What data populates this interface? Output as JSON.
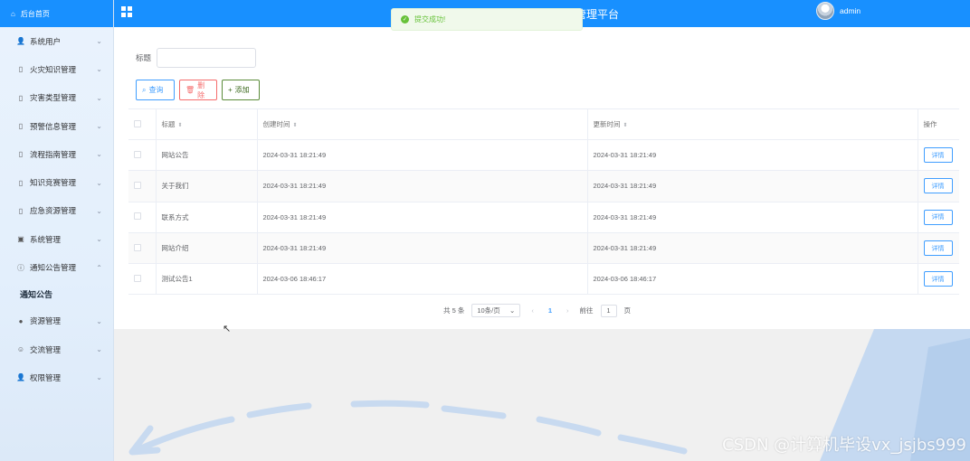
{
  "sidebar": {
    "home": "后台首页",
    "items": [
      {
        "label": "系统用户",
        "icon": "user-icon",
        "expanded": false
      },
      {
        "label": "火灾知识管理",
        "icon": "document-icon",
        "expanded": false
      },
      {
        "label": "灾害类型管理",
        "icon": "document-icon",
        "expanded": false
      },
      {
        "label": "预警信息管理",
        "icon": "document-icon",
        "expanded": false
      },
      {
        "label": "流程指南管理",
        "icon": "document-icon",
        "expanded": false
      },
      {
        "label": "知识竞赛管理",
        "icon": "document-icon",
        "expanded": false
      },
      {
        "label": "应急资源管理",
        "icon": "document-icon",
        "expanded": false
      },
      {
        "label": "系统管理",
        "icon": "picture-icon",
        "expanded": false
      },
      {
        "label": "通知公告管理",
        "icon": "info-icon",
        "expanded": true
      }
    ],
    "sub_item": "通知公告",
    "items_after": [
      {
        "label": "资源管理",
        "icon": "location-icon"
      },
      {
        "label": "交流管理",
        "icon": "chat-icon"
      },
      {
        "label": "权限管理",
        "icon": "user-icon"
      }
    ]
  },
  "header": {
    "title": "管理平台",
    "username": "admin"
  },
  "toast": {
    "message": "提交成功!",
    "status_color": "#67c23a"
  },
  "search": {
    "label": "标题",
    "value": ""
  },
  "buttons": {
    "query": "查询",
    "delete": "删除",
    "add": "添加"
  },
  "table": {
    "headers": {
      "title": "标题",
      "created": "创建时间",
      "updated": "更新时间",
      "actions": "操作"
    },
    "rows": [
      {
        "title": "网站公告",
        "created": "2024-03-31 18:21:49",
        "updated": "2024-03-31 18:21:49",
        "action": "详情"
      },
      {
        "title": "关于我们",
        "created": "2024-03-31 18:21:49",
        "updated": "2024-03-31 18:21:49",
        "action": "详情"
      },
      {
        "title": "联系方式",
        "created": "2024-03-31 18:21:49",
        "updated": "2024-03-31 18:21:49",
        "action": "详情"
      },
      {
        "title": "网站介绍",
        "created": "2024-03-31 18:21:49",
        "updated": "2024-03-31 18:21:49",
        "action": "详情"
      },
      {
        "title": "测试公告1",
        "created": "2024-03-06 18:46:17",
        "updated": "2024-03-06 18:46:17",
        "action": "详情"
      }
    ]
  },
  "pagination": {
    "total": "共 5 条",
    "page_size": "10条/页",
    "current_page": "1",
    "goto_label": "前往",
    "goto_value": "1",
    "page_suffix": "页"
  },
  "watermark": "CSDN @计算机毕设vx_jsjbs999",
  "colors": {
    "primary": "#1890ff",
    "link": "#409eff",
    "danger": "#f56c6c"
  }
}
